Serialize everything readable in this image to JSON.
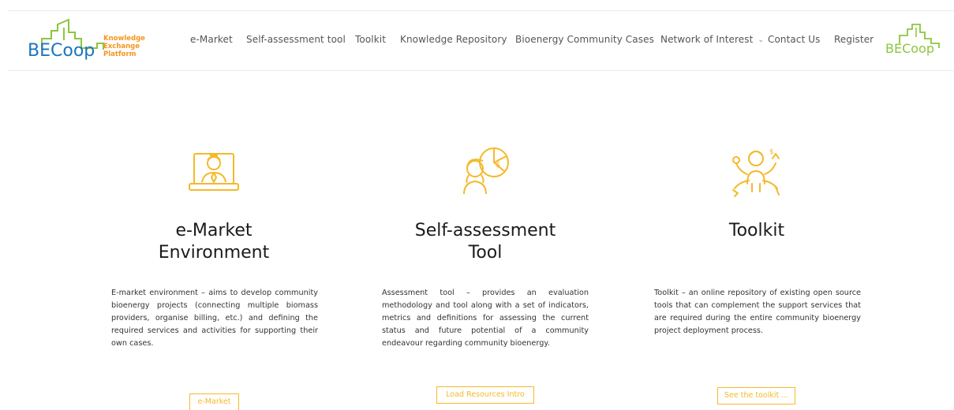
{
  "brand": {
    "logo_main": "BECoop",
    "logo_tag_line1": "Knowledge",
    "logo_tag_line2": "Exchange",
    "logo_tag_line3": "Platform",
    "logo_right": "BECoop",
    "green": "#8cc63f",
    "orange": "#f7941d",
    "blue": "#1b75bc",
    "accent": "#f4b92a"
  },
  "nav": {
    "items": [
      {
        "label": "e-Market"
      },
      {
        "label": "Self-assessment tool"
      },
      {
        "label": "Toolkit"
      },
      {
        "label": "Knowledge Repository"
      },
      {
        "label": "Bioenergy Community Cases"
      },
      {
        "label": "Network of Interest"
      },
      {
        "label": "Contact Us"
      },
      {
        "label": "Register"
      }
    ]
  },
  "sections": [
    {
      "icon": "person-laptop-icon",
      "title_line1": "e-Market",
      "title_line2": "Environment",
      "text": "E-market environment – aims to develop community bioenergy projects (connecting multiple biomass providers, organise billing, etc.) and defining the required services and activities for supporting their own cases.",
      "button": "e-Market"
    },
    {
      "icon": "person-chart-icon",
      "title_line1": "Self-assessment",
      "title_line2": "Tool",
      "text": "Assessment tool – provides an evaluation methodology and tool along with a set of indicators, metrics and definitions for assessing the current status and future potential of a community endeavour regarding community bioenergy.",
      "button": "Load Resources Intro"
    },
    {
      "icon": "multitasking-person-icon",
      "title_line1": "Toolkit",
      "title_line2": "",
      "text": "Toolkit – an online repository of existing open source tools that can complement the support services that are required during the entire community bioenergy project deployment process.",
      "button": "See the toolkit ..."
    }
  ]
}
